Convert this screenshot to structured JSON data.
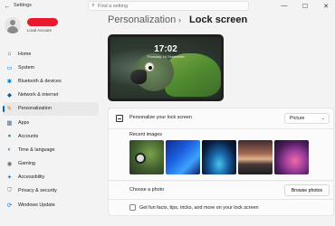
{
  "window": {
    "app_title": "Settings",
    "search_placeholder": "Find a setting",
    "minimize": "—",
    "maximize": "☐",
    "close": "✕"
  },
  "profile": {
    "sub_label": "Local Account"
  },
  "sidebar": {
    "items": [
      {
        "label": "Home",
        "icon": "home-icon",
        "glyph": "⌂",
        "color": "#444444"
      },
      {
        "label": "System",
        "icon": "monitor-icon",
        "glyph": "▭",
        "color": "#0078d4"
      },
      {
        "label": "Bluetooth & devices",
        "icon": "bluetooth-icon",
        "glyph": "✱",
        "color": "#0078d4"
      },
      {
        "label": "Network & internet",
        "icon": "wifi-icon",
        "glyph": "◆",
        "color": "#0a5ca8"
      },
      {
        "label": "Personalization",
        "icon": "brush-icon",
        "glyph": "✎",
        "color": "#d66a1f"
      },
      {
        "label": "Apps",
        "icon": "apps-icon",
        "glyph": "▦",
        "color": "#5a6b80"
      },
      {
        "label": "Accounts",
        "icon": "accounts-icon",
        "glyph": "●",
        "color": "#22a06b"
      },
      {
        "label": "Time & language",
        "icon": "globe-icon",
        "glyph": "◐",
        "color": "#1a73c9"
      },
      {
        "label": "Gaming",
        "icon": "gamepad-icon",
        "glyph": "◉",
        "color": "#6b6b6b"
      },
      {
        "label": "Accessibility",
        "icon": "accessibility-icon",
        "glyph": "✦",
        "color": "#1a6fd1"
      },
      {
        "label": "Privacy & security",
        "icon": "shield-icon",
        "glyph": "⛉",
        "color": "#5f6b78"
      },
      {
        "label": "Windows Update",
        "icon": "update-icon",
        "glyph": "⟳",
        "color": "#0a74c9"
      }
    ],
    "active_index": 4
  },
  "breadcrumb": {
    "parent": "Personalization",
    "separator": "›",
    "current": "Lock screen"
  },
  "preview": {
    "time": "17:02",
    "date": "Thursday, 14 September"
  },
  "settings": {
    "personalize_label": "Personalize your lock screen",
    "personalize_value": "Picture",
    "recent_images_label": "Recent images",
    "choose_photo_label": "Choose a photo",
    "browse_button": "Browse photos",
    "fun_facts_label": "Get fun facts, tips, tricks, and more on your lock screen"
  }
}
